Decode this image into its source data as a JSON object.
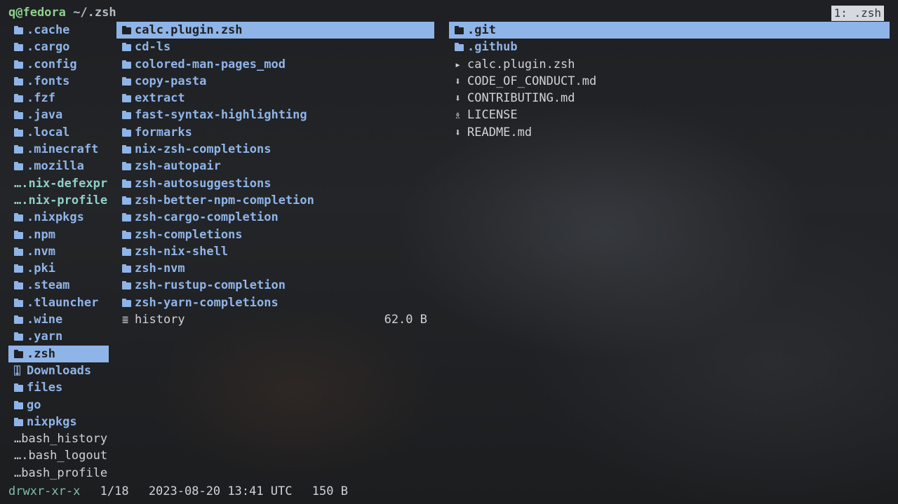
{
  "title": {
    "user_host": "q@fedora",
    "path": "~/.zsh"
  },
  "tab_badge": "1: .zsh",
  "parent_column": [
    {
      "name": ".cache",
      "kind": "dir"
    },
    {
      "name": ".cargo",
      "kind": "dir"
    },
    {
      "name": ".config",
      "kind": "dir"
    },
    {
      "name": ".fonts",
      "kind": "dir"
    },
    {
      "name": ".fzf",
      "kind": "dir"
    },
    {
      "name": ".java",
      "kind": "dir"
    },
    {
      "name": ".local",
      "kind": "dir"
    },
    {
      "name": ".minecraft",
      "kind": "dir"
    },
    {
      "name": ".mozilla",
      "kind": "dir"
    },
    {
      "name": "….nix-defexpr",
      "kind": "link"
    },
    {
      "name": "….nix-profile",
      "kind": "link"
    },
    {
      "name": ".nixpkgs",
      "kind": "dir"
    },
    {
      "name": ".npm",
      "kind": "dir"
    },
    {
      "name": ".nvm",
      "kind": "dir"
    },
    {
      "name": ".pki",
      "kind": "dir"
    },
    {
      "name": ".steam",
      "kind": "dir"
    },
    {
      "name": ".tlauncher",
      "kind": "dir"
    },
    {
      "name": ".wine",
      "kind": "dir"
    },
    {
      "name": ".yarn",
      "kind": "dir"
    },
    {
      "name": ".zsh",
      "kind": "dir",
      "selected": true
    },
    {
      "name": "Downloads",
      "kind": "download-dir"
    },
    {
      "name": "files",
      "kind": "dir"
    },
    {
      "name": "go",
      "kind": "dir"
    },
    {
      "name": "nixpkgs",
      "kind": "dir"
    },
    {
      "name": "…bash_history",
      "kind": "file"
    },
    {
      "name": "….bash_logout",
      "kind": "file"
    },
    {
      "name": "…bash_profile",
      "kind": "file"
    }
  ],
  "current_column": [
    {
      "name": "calc.plugin.zsh",
      "kind": "dir",
      "selected": true
    },
    {
      "name": "cd-ls",
      "kind": "dir"
    },
    {
      "name": "colored-man-pages_mod",
      "kind": "dir"
    },
    {
      "name": "copy-pasta",
      "kind": "dir"
    },
    {
      "name": "extract",
      "kind": "dir"
    },
    {
      "name": "fast-syntax-highlighting",
      "kind": "dir"
    },
    {
      "name": "formarks",
      "kind": "dir"
    },
    {
      "name": "nix-zsh-completions",
      "kind": "dir"
    },
    {
      "name": "zsh-autopair",
      "kind": "dir"
    },
    {
      "name": "zsh-autosuggestions",
      "kind": "dir"
    },
    {
      "name": "zsh-better-npm-completion",
      "kind": "dir"
    },
    {
      "name": "zsh-cargo-completion",
      "kind": "dir"
    },
    {
      "name": "zsh-completions",
      "kind": "dir"
    },
    {
      "name": "zsh-nix-shell",
      "kind": "dir"
    },
    {
      "name": "zsh-nvm",
      "kind": "dir"
    },
    {
      "name": "zsh-rustup-completion",
      "kind": "dir"
    },
    {
      "name": "zsh-yarn-completions",
      "kind": "dir"
    },
    {
      "name": "history",
      "kind": "text-file",
      "size": "62.0 B"
    }
  ],
  "preview_column": [
    {
      "name": ".git",
      "kind": "git-dir",
      "selected": true
    },
    {
      "name": ".github",
      "kind": "dir"
    },
    {
      "name": "calc.plugin.zsh",
      "kind": "script"
    },
    {
      "name": "CODE_OF_CONDUCT.md",
      "kind": "download"
    },
    {
      "name": "CONTRIBUTING.md",
      "kind": "download"
    },
    {
      "name": "LICENSE",
      "kind": "license"
    },
    {
      "name": "README.md",
      "kind": "download"
    }
  ],
  "status": {
    "permissions": "drwxr-xr-x",
    "position": "1/18",
    "modified": "2023-08-20 13:41 UTC",
    "size": "150 B"
  },
  "colors": {
    "dir": "#8fb4e8",
    "selection": "#8fb4e8",
    "prompt": "#8fcf8f",
    "link": "#8fd0c8"
  }
}
